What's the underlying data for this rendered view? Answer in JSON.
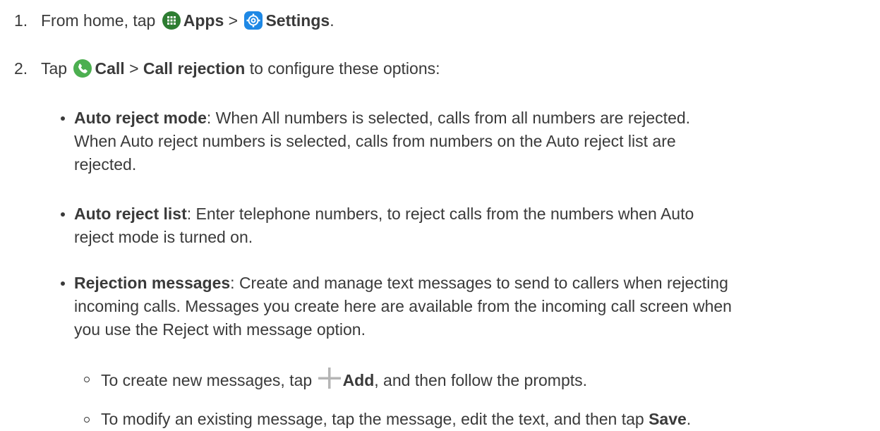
{
  "step1": {
    "number": "1.",
    "prefix": "From home, tap",
    "apps_label": "Apps",
    "separator": ">",
    "settings_label": "Settings",
    "suffix": ".",
    "apps_icon": "apps-grid-icon",
    "settings_icon": "settings-gear-icon"
  },
  "step2": {
    "number": "2.",
    "prefix": "Tap",
    "call_label": "Call",
    "separator": ">",
    "call_rejection_label": "Call rejection",
    "suffix": "to configure these options:",
    "call_icon": "phone-call-icon"
  },
  "options": [
    {
      "term": "Auto reject mode",
      "description_line1": ": When All numbers is selected, calls from all numbers are rejected.",
      "description_line2": "When Auto reject numbers is selected, calls from numbers on the Auto reject list are",
      "description_line3": "rejected."
    },
    {
      "term": "Auto reject list",
      "description_line1": ": Enter telephone numbers, to reject calls from the numbers when Auto",
      "description_line2": "reject mode is turned on."
    },
    {
      "term": "Rejection messages",
      "description_line1": ": Create and manage text messages to send to callers when rejecting",
      "description_line2": "incoming calls. Messages you create here are available from the incoming call screen when",
      "description_line3": "you use the Reject with message option."
    }
  ],
  "subitems": [
    {
      "prefix": "To create new messages, tap",
      "action": "Add",
      "suffix": ", and then follow the prompts.",
      "icon": "plus-icon"
    },
    {
      "prefix": "To modify an existing message, tap the message, edit the text, and then tap",
      "action": "Save",
      "suffix": "."
    }
  ],
  "colors": {
    "text": "#3a3a3a",
    "apps_icon_bg": "#2e7d32",
    "settings_icon_bg": "#1e88e5",
    "call_icon_bg": "#4caf50",
    "plus_icon": "#b5b5b5"
  }
}
